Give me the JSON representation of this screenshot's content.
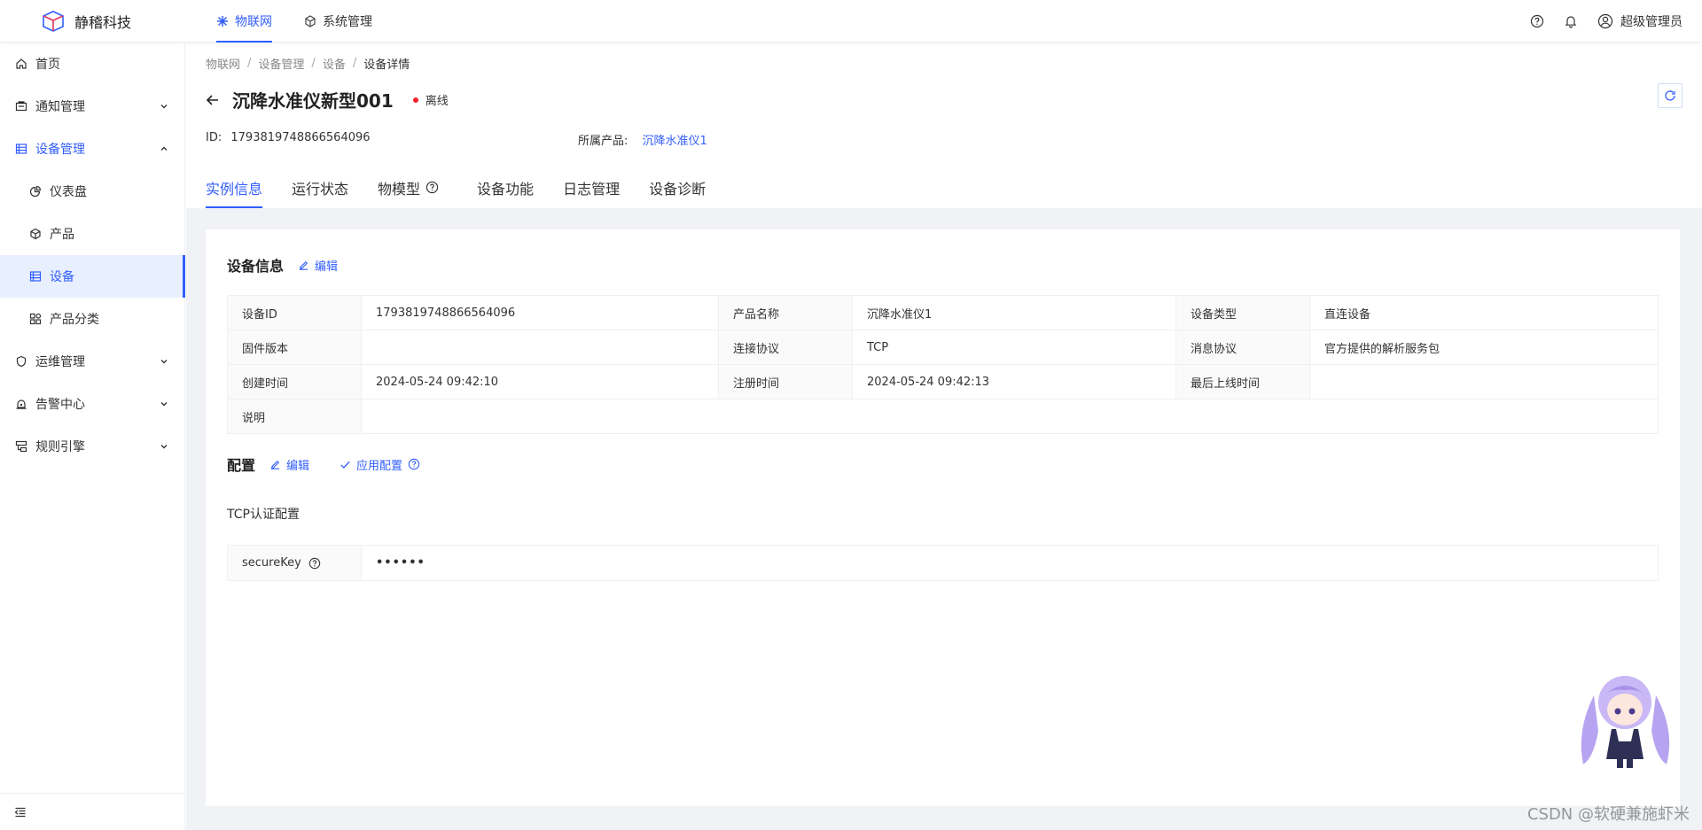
{
  "brand": {
    "name": "静稽科技",
    "accent": "#315efb"
  },
  "topnav": {
    "items": [
      {
        "label": "物联网",
        "icon": "snowflake-icon",
        "active": true
      },
      {
        "label": "系统管理",
        "icon": "cube-outline-icon",
        "active": false
      }
    ],
    "user": "超级管理员"
  },
  "sidebar": {
    "items": [
      {
        "label": "首页",
        "icon": "home-icon"
      },
      {
        "label": "通知管理",
        "icon": "notice-icon"
      },
      {
        "label": "设备管理",
        "icon": "list-icon"
      },
      {
        "label": "仪表盘",
        "icon": "pie-chart-icon"
      },
      {
        "label": "产品",
        "icon": "cube-icon"
      },
      {
        "label": "设备",
        "icon": "list-icon"
      },
      {
        "label": "产品分类",
        "icon": "category-icon"
      },
      {
        "label": "运维管理",
        "icon": "shield-icon"
      },
      {
        "label": "告警中心",
        "icon": "alarm-icon"
      },
      {
        "label": "规则引擎",
        "icon": "flow-icon"
      }
    ]
  },
  "breadcrumb": [
    "物联网",
    "设备管理",
    "设备",
    "设备详情"
  ],
  "device": {
    "title": "沉降水准仪新型001",
    "status": "离线",
    "status_color": "#f5222d",
    "id_label": "ID:",
    "id": "1793819748866564096",
    "product_label": "所属产品:",
    "product": "沉降水准仪1"
  },
  "tabs": [
    "实例信息",
    "运行状态",
    "物模型",
    "设备功能",
    "日志管理",
    "设备诊断"
  ],
  "info": {
    "title": "设备信息",
    "edit": "编辑",
    "rows": [
      [
        "设备ID",
        "1793819748866564096",
        "产品名称",
        "沉降水准仪1",
        "设备类型",
        "直连设备"
      ],
      [
        "固件版本",
        "",
        "连接协议",
        "TCP",
        "消息协议",
        "官方提供的解析服务包"
      ],
      [
        "创建时间",
        "2024-05-24 09:42:10",
        "注册时间",
        "2024-05-24 09:42:13",
        "最后上线时间",
        ""
      ],
      [
        "说明",
        ""
      ]
    ]
  },
  "config": {
    "title": "配置",
    "edit": "编辑",
    "apply": "应用配置",
    "subtitle": "TCP认证配置",
    "key_label": "secureKey",
    "key_value": "••••••"
  },
  "watermark": "CSDN @软硬兼施虾米"
}
